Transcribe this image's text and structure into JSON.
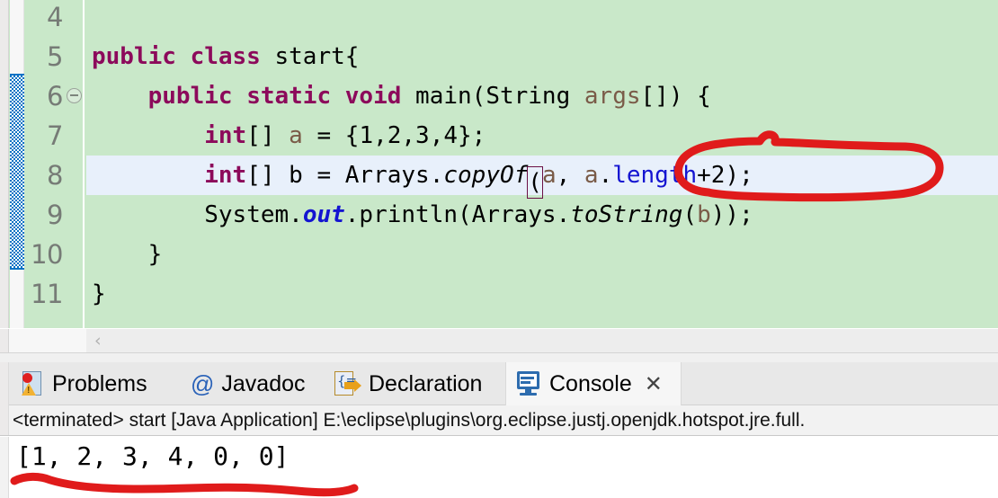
{
  "editor": {
    "lines": [
      {
        "number": "4",
        "tokens": [],
        "folding": false,
        "highlighted": false
      },
      {
        "number": "5",
        "folding": false,
        "highlighted": false,
        "tokens": [
          {
            "t": "public class ",
            "c": "k"
          },
          {
            "t": "start{",
            "c": "plain"
          }
        ]
      },
      {
        "number": "6",
        "folding": true,
        "highlighted": false,
        "tokens": [
          {
            "t": "    ",
            "c": "plain"
          },
          {
            "t": "public static void ",
            "c": "k"
          },
          {
            "t": "main(String ",
            "c": "plain"
          },
          {
            "t": "args",
            "c": "fld"
          },
          {
            "t": "[]) {",
            "c": "plain"
          }
        ]
      },
      {
        "number": "7",
        "folding": false,
        "highlighted": false,
        "tokens": [
          {
            "t": "        ",
            "c": "plain"
          },
          {
            "t": "int",
            "c": "k"
          },
          {
            "t": "[] ",
            "c": "plain"
          },
          {
            "t": "a",
            "c": "fld"
          },
          {
            "t": " = {1,2,3,4};",
            "c": "plain"
          }
        ]
      },
      {
        "number": "8",
        "folding": false,
        "highlighted": true,
        "tokens": [
          {
            "t": "        ",
            "c": "plain"
          },
          {
            "t": "int",
            "c": "k"
          },
          {
            "t": "[] b = Arrays.",
            "c": "plain"
          },
          {
            "t": "copyOf",
            "c": "mth"
          },
          {
            "t": "(",
            "c": "brkt-box"
          },
          {
            "t": "a",
            "c": "fld"
          },
          {
            "t": ", ",
            "c": "plain"
          },
          {
            "t": "a",
            "c": "fld"
          },
          {
            "t": ".",
            "c": "plain"
          },
          {
            "t": "length",
            "c": "lenv"
          },
          {
            "t": "+2);",
            "c": "plain"
          }
        ]
      },
      {
        "number": "9",
        "folding": false,
        "highlighted": false,
        "tokens": [
          {
            "t": "        ",
            "c": "plain"
          },
          {
            "t": "System.",
            "c": "plain"
          },
          {
            "t": "out",
            "c": "stc"
          },
          {
            "t": ".println(Arrays.",
            "c": "plain"
          },
          {
            "t": "toString",
            "c": "mth"
          },
          {
            "t": "(",
            "c": "plain"
          },
          {
            "t": "b",
            "c": "fld"
          },
          {
            "t": "));",
            "c": "plain"
          }
        ]
      },
      {
        "number": "10",
        "folding": false,
        "highlighted": false,
        "tokens": [
          {
            "t": "    }",
            "c": "plain"
          }
        ]
      },
      {
        "number": "11",
        "folding": false,
        "highlighted": false,
        "tokens": [
          {
            "t": "}",
            "c": "plain"
          }
        ]
      }
    ],
    "full_code_text": [
      "",
      "public class start{",
      "    public static void main(String args[]) {",
      "        int[] a = {1,2,3,4};",
      "        int[] b = Arrays.copyOf(a, a.length+2);",
      "        System.out.println(Arrays.toString(b));",
      "    }",
      "}"
    ],
    "scroll_chevron": "‹",
    "colors": {
      "background": "#c9e8c9",
      "highlight_line": "#e8f0fb",
      "keyword": "#8c0a5b",
      "field": "#7a5b48",
      "static_field": "#1414d1",
      "line_number": "#767b76",
      "change_bar": "#0a72c4"
    }
  },
  "bottom_panel": {
    "tabs": [
      {
        "label": "Problems",
        "icon": "problems-icon",
        "active": false,
        "closable": false
      },
      {
        "label": "Javadoc",
        "icon": "at-sign-icon",
        "active": false,
        "closable": false
      },
      {
        "label": "Declaration",
        "icon": "declaration-icon",
        "active": false,
        "closable": false
      },
      {
        "label": "Console",
        "icon": "console-icon",
        "active": true,
        "closable": true
      }
    ],
    "close_glyph": "✕",
    "status": "<terminated> start [Java Application] E:\\eclipse\\plugins\\org.eclipse.justj.openjdk.hotspot.jre.full.",
    "output": "[1, 2, 3, 4, 0, 0]"
  },
  "annotations": {
    "color": "#e01b1b",
    "items": [
      {
        "name": "circle-around-a-length-plus-2",
        "shape": "ellipse-hand-drawn",
        "target": "a.length+2);"
      },
      {
        "name": "underline-console-output",
        "shape": "line-hand-drawn",
        "target": "[1, 2, 3, 4, 0, 0]"
      }
    ]
  }
}
